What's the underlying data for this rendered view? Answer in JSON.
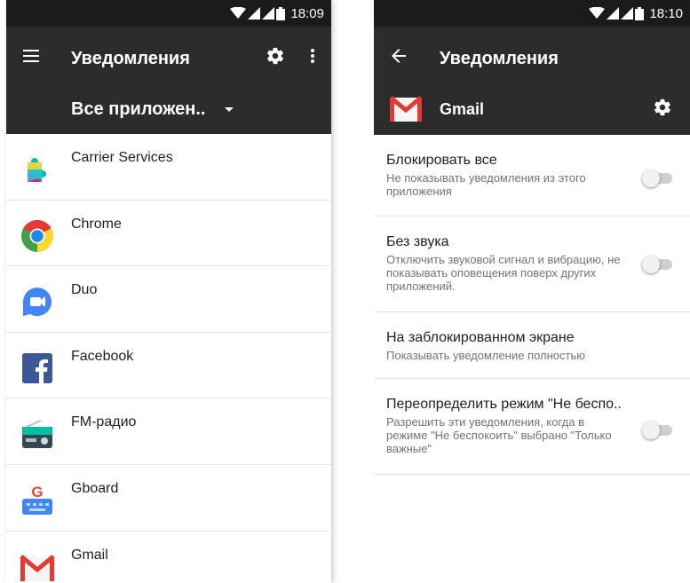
{
  "left": {
    "status_time": "18:09",
    "toolbar_title": "Уведомления",
    "filter_label": "Все приложен..",
    "apps": [
      {
        "name": "Carrier Services",
        "icon": "carrier-services-icon"
      },
      {
        "name": "Chrome",
        "icon": "chrome-icon"
      },
      {
        "name": "Duo",
        "icon": "duo-icon"
      },
      {
        "name": "Facebook",
        "icon": "facebook-icon"
      },
      {
        "name": "FM-радио",
        "icon": "fm-radio-icon"
      },
      {
        "name": "Gboard",
        "icon": "gboard-icon"
      },
      {
        "name": "Gmail",
        "icon": "gmail-icon"
      }
    ]
  },
  "right": {
    "status_time": "18:10",
    "toolbar_title": "Уведомления",
    "app_name": "Gmail",
    "settings": [
      {
        "title": "Блокировать все",
        "summary": "Не показывать уведомления из этого приложения",
        "switch_on": false
      },
      {
        "title": "Без звука",
        "summary": "Отключить звуковой сигнал и вибрацию, не показывать оповещения поверх других приложений.",
        "switch_on": false
      },
      {
        "title": "На заблокированном экране",
        "summary": "Показывать уведомление полностью"
      },
      {
        "title": "Переопределить режим \"Не беспо..",
        "summary": "Разрешить эти уведомления, когда в режиме \"Не беспокоить\" выбрано \"Только важные\"",
        "switch_on": false
      }
    ]
  },
  "colors": {
    "toolbar": "#2c2c2c",
    "statusbar": "#1b1b1b",
    "gmail_red": "#e53935"
  }
}
